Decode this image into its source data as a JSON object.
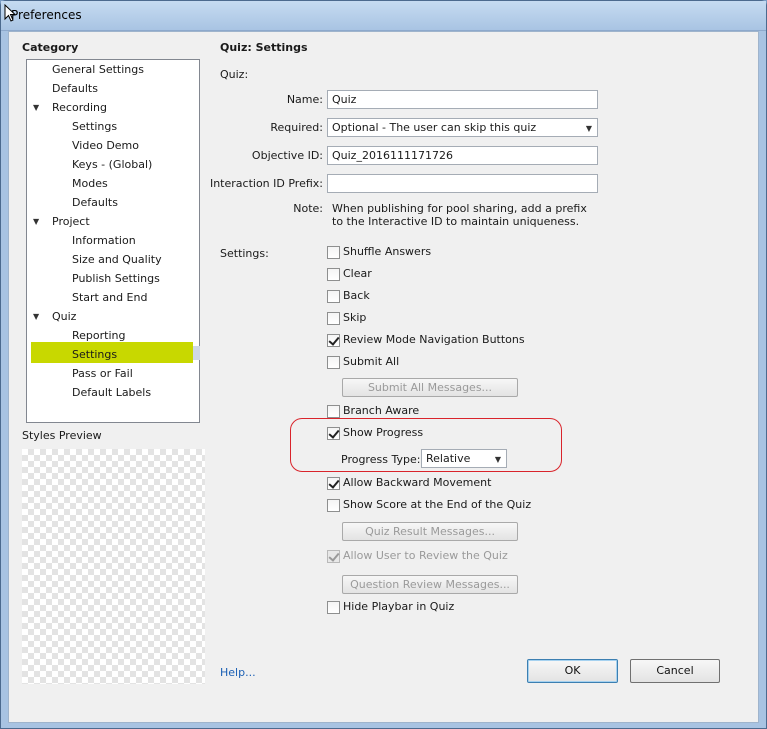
{
  "window": {
    "title": "Preferences"
  },
  "sidebar": {
    "heading": "Category",
    "items": [
      {
        "label": "General Settings",
        "level": 0
      },
      {
        "label": "Defaults",
        "level": 0
      },
      {
        "label": "Recording",
        "level": 0,
        "expanded": true
      },
      {
        "label": "Settings",
        "level": 1
      },
      {
        "label": "Video Demo",
        "level": 1
      },
      {
        "label": "Keys - (Global)",
        "level": 1
      },
      {
        "label": "Modes",
        "level": 1
      },
      {
        "label": "Defaults",
        "level": 1
      },
      {
        "label": "Project",
        "level": 0,
        "expanded": true
      },
      {
        "label": "Information",
        "level": 1
      },
      {
        "label": "Size and Quality",
        "level": 1
      },
      {
        "label": "Publish Settings",
        "level": 1
      },
      {
        "label": "Start and End",
        "level": 1
      },
      {
        "label": "Quiz",
        "level": 0,
        "expanded": true
      },
      {
        "label": "Reporting",
        "level": 1
      },
      {
        "label": "Settings",
        "level": 1,
        "selected": true
      },
      {
        "label": "Pass or Fail",
        "level": 1
      },
      {
        "label": "Default Labels",
        "level": 1
      }
    ],
    "styles_preview_label": "Styles Preview"
  },
  "main": {
    "title": "Quiz: Settings",
    "quiz_section_label": "Quiz:",
    "name_label": "Name:",
    "name_value": "Quiz",
    "required_label": "Required:",
    "required_value": "Optional - The user can skip this quiz",
    "objective_label": "Objective ID:",
    "objective_value": "Quiz_2016111171726",
    "interaction_label": "Interaction ID Prefix:",
    "interaction_value": "",
    "note_label": "Note:",
    "note_line1": "When publishing for pool sharing, add a prefix",
    "note_line2": "to the Interactive ID to maintain uniqueness.",
    "settings_label": "Settings:",
    "checkboxes": {
      "shuffle_answers": {
        "label": "Shuffle Answers",
        "checked": false
      },
      "clear": {
        "label": "Clear",
        "checked": false
      },
      "back": {
        "label": "Back",
        "checked": false
      },
      "skip": {
        "label": "Skip",
        "checked": false
      },
      "review_mode_nav": {
        "label": "Review Mode Navigation Buttons",
        "checked": true
      },
      "submit_all": {
        "label": "Submit All",
        "checked": false
      },
      "branch_aware": {
        "label": "Branch Aware",
        "checked": false
      },
      "show_progress": {
        "label": "Show Progress",
        "checked": true
      },
      "allow_backward": {
        "label": "Allow Backward Movement",
        "checked": true
      },
      "show_score": {
        "label": "Show Score at the End of the Quiz",
        "checked": false
      },
      "allow_review": {
        "label": "Allow User to Review the Quiz",
        "checked": true,
        "disabled": true
      },
      "hide_playbar": {
        "label": "Hide Playbar in Quiz",
        "checked": false
      }
    },
    "submit_all_messages_button": "Submit All Messages...",
    "progress_type_label": "Progress Type:",
    "progress_type_value": "Relative",
    "quiz_result_messages_button": "Quiz Result Messages...",
    "question_review_messages_button": "Question Review Messages..."
  },
  "footer": {
    "help_link": "Help...",
    "ok_button": "OK",
    "cancel_button": "Cancel"
  },
  "colors": {
    "selection_highlight": "#c8d800",
    "annotation_ring": "#d9242b",
    "link": "#1a5fb4"
  }
}
